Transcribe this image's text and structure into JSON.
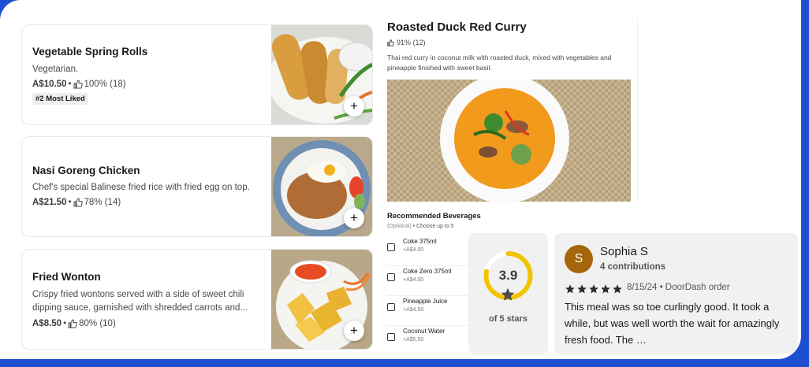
{
  "items": [
    {
      "name": "Vegetable Spring Rolls",
      "description": "Vegetarian.",
      "price": "A$10.50",
      "rating": "100% (18)",
      "badge": "#2 Most Liked",
      "add_label": "+"
    },
    {
      "name": "Nasi Goreng Chicken",
      "description": "Chef's special Balinese fried rice with fried egg on top.",
      "price": "A$21.50",
      "rating": "78% (14)",
      "add_label": "+"
    },
    {
      "name": "Fried Wonton",
      "description": "Crispy fried wontons served with a side of sweet chili dipping sauce, garnished with shredded carrots and...",
      "price": "A$8.50",
      "rating": "80% (10)",
      "add_label": "+"
    }
  ],
  "meta_separator": "•",
  "detail": {
    "title": "Roasted Duck Red Curry",
    "rating": "91% (12)",
    "description": "Thai red curry in coconut milk with roasted duck, mixed with vegetables and pineapple finished with sweet basil.",
    "beverages_heading": "Recommended Beverages",
    "beverages_optional": "(Optional)",
    "beverages_choose": "Choose up to 5",
    "beverages": [
      {
        "name": "Coke 375ml",
        "price": "+A$4.00"
      },
      {
        "name": "Coke Zero 375ml",
        "price": "+A$4.00"
      },
      {
        "name": "Pineapple Juice",
        "price": "+A$4.50"
      },
      {
        "name": "Coconut Water",
        "price": "+A$5.50"
      }
    ]
  },
  "rating_summary": {
    "score": "3.9",
    "score_value": 3.9,
    "out_of": 5,
    "label": "of 5 stars"
  },
  "review": {
    "avatar_letter": "S",
    "name": "Sophia S",
    "contributions": "4 contributions",
    "stars": 5,
    "date": "8/15/24 • DoorDash order",
    "text": "This meal was so toe curlingly good. It took a while, but was well worth the wait for amazingly fresh food. The …"
  },
  "colors": {
    "background_frame": "#1f4fd1",
    "rating_ring": "#f2c400",
    "avatar": "#a5650a"
  }
}
